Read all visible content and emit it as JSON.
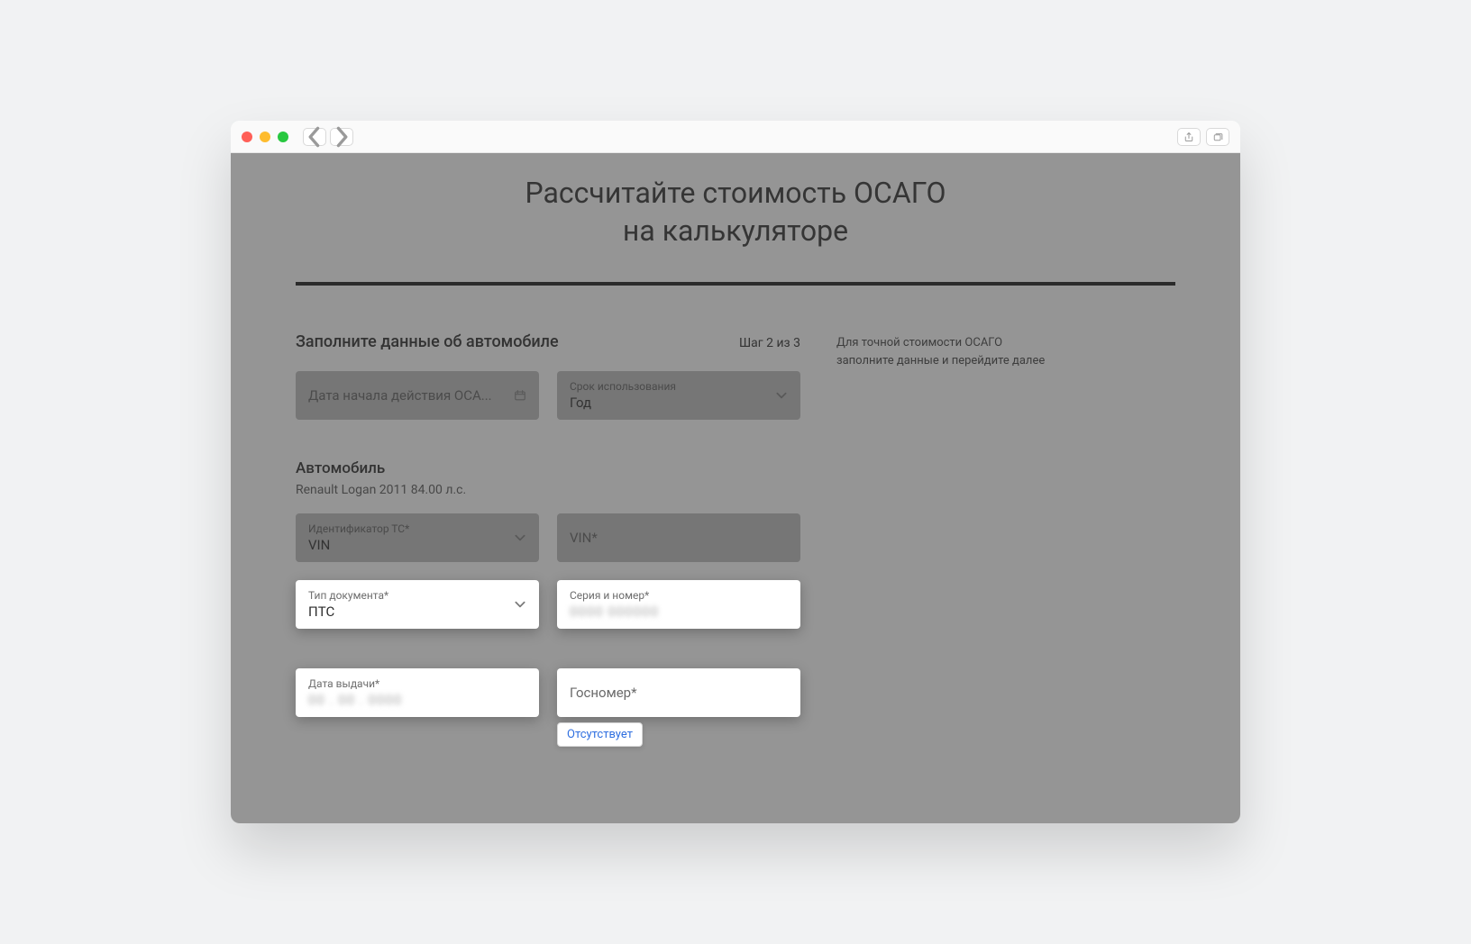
{
  "page": {
    "title_line1": "Рассчитайте стоимость ОСАГО",
    "title_line2": "на калькуляторе"
  },
  "sidebar_hint": {
    "line1": "Для точной стоимости ОСАГО",
    "line2": "заполните данные и перейдите далее"
  },
  "form": {
    "section_title": "Заполните данные об автомобиле",
    "step_label": "Шаг 2 из 3",
    "policy_start": {
      "placeholder": "Дата начала действия ОСА..."
    },
    "usage_period": {
      "label": "Срок использования",
      "value": "Год"
    },
    "vehicle_section_title": "Автомобиль",
    "vehicle_summary": "Renault Logan 2011 84.00 л.с.",
    "vehicle_id_type": {
      "label": "Идентификатор ТС*",
      "value": "VIN"
    },
    "vin": {
      "placeholder": "VIN*"
    },
    "doc_type": {
      "label": "Тип документа*",
      "value": "ПТС"
    },
    "doc_number": {
      "label": "Серия и номер*",
      "value": "0000 000000"
    },
    "issue_date": {
      "label": "Дата выдачи*",
      "value": "00 . 00 . 0000"
    },
    "plate": {
      "label": "Госномер*",
      "badge": "Отсутствует"
    }
  }
}
